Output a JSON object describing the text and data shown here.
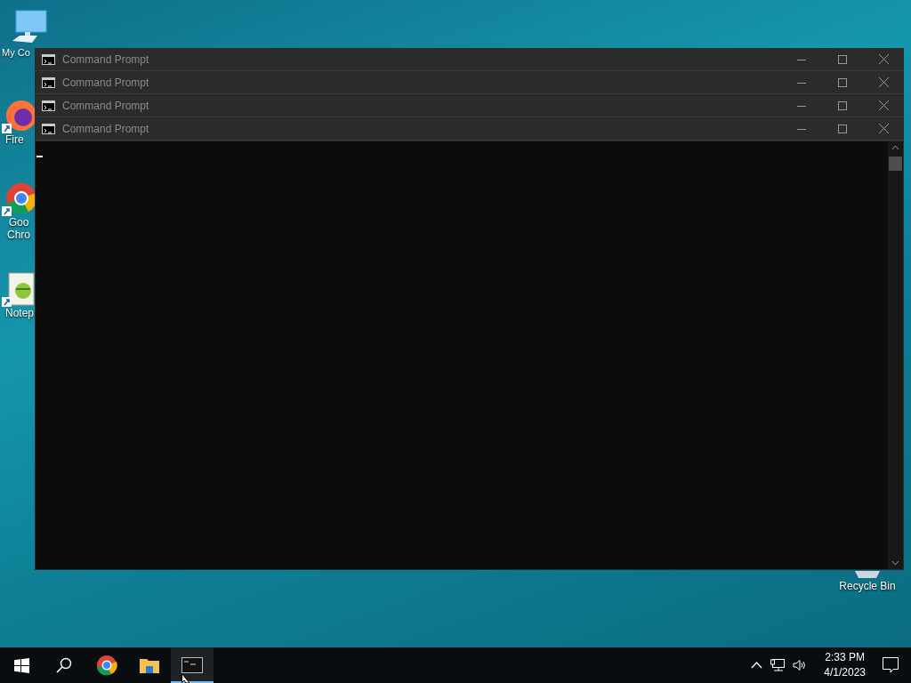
{
  "desktop_icons": [
    {
      "kind": "computer",
      "label": "My Co"
    },
    {
      "kind": "firefox",
      "label": "Fire"
    },
    {
      "kind": "chrome",
      "label": "Goo Chro"
    },
    {
      "kind": "notepad",
      "label": "Notep"
    },
    {
      "kind": "recycle",
      "label": "Recycle Bin"
    }
  ],
  "windows": [
    {
      "title": "Command Prompt"
    },
    {
      "title": "Command Prompt"
    },
    {
      "title": "Command Prompt"
    },
    {
      "title": "Command Prompt"
    }
  ],
  "taskbar": {
    "items": [
      {
        "kind": "start",
        "selected": false
      },
      {
        "kind": "search",
        "selected": false
      },
      {
        "kind": "chrome",
        "selected": false
      },
      {
        "kind": "explorer",
        "selected": false
      },
      {
        "kind": "cmd",
        "selected": true
      }
    ],
    "time": "2:33 PM",
    "date": "4/1/2023"
  }
}
